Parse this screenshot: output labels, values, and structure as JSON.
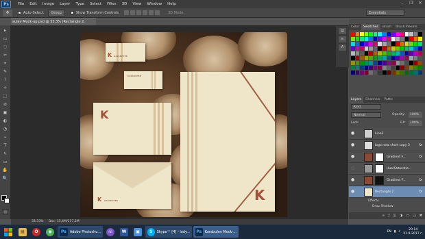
{
  "app": {
    "logo": "Ps"
  },
  "menu": [
    "File",
    "Edit",
    "Image",
    "Layer",
    "Type",
    "Select",
    "Filter",
    "3D",
    "View",
    "Window",
    "Help"
  ],
  "window_controls": [
    "–",
    "❐",
    "✕"
  ],
  "options_bar": {
    "auto_select_label": "Auto-Select:",
    "auto_select_value": "Group",
    "show_transform_label": "Show Transform Controls",
    "mode_3d_label": "3D Mode:",
    "workspace": "Essentials"
  },
  "document": {
    "tab_title": "aulev Mock-up.psd @ 33,3% (Rectangle 2, RGB/8)",
    "status": "Doc: 15,4M/117,2M",
    "zoom": "33.33%"
  },
  "mockup": {
    "brand_name": "КАРАБУЛЕВ",
    "logo_letter": "K"
  },
  "tools": [
    "▸",
    "▭",
    "◌",
    "✂",
    "⌖",
    "✎",
    "⌇",
    "✧",
    "⬚",
    "⊘",
    "▣",
    "◐",
    "◔",
    "⌁",
    "T",
    "↖",
    "▭",
    "✋",
    "🔍"
  ],
  "panels": {
    "color_tabs": [
      "Color",
      "Swatches",
      "Brush",
      "Brush Presets"
    ],
    "active_color_tab": "Swatches",
    "layers_tabs": [
      "Layers",
      "Channels",
      "Paths"
    ],
    "filter_kind": "Kind",
    "blend_mode": "Normal",
    "opacity_label": "Opacity:",
    "opacity_value": "100%",
    "lock_label": "Lock:",
    "fill_label": "Fill:",
    "fill_value": "100%"
  },
  "layers": [
    {
      "name": "Line2",
      "fx": ""
    },
    {
      "name": "logo new short copy 3",
      "fx": "fx"
    },
    {
      "name": "Gradient F...",
      "fx": "fx"
    },
    {
      "name": "Hue/Saturatio...",
      "fx": ""
    },
    {
      "name": "Gradient F...",
      "fx": "fx"
    },
    {
      "name": "Rectangle 2",
      "fx": "fx",
      "selected": true
    }
  ],
  "layer_effects": {
    "label": "Effects",
    "item": "Drop Shadow"
  },
  "taskbar": {
    "items": [
      {
        "label": "Adobe Photosho...",
        "icon": "Ps"
      },
      {
        "label": "Skype™ [4] - lady...",
        "icon": "S"
      },
      {
        "label": "Karabulev Mock-...",
        "icon": "Ps"
      }
    ],
    "language": "EN",
    "time": "20:14",
    "date": "21.9.2017 г."
  },
  "colors": {
    "accent": "#6d8cb4",
    "swatches": [
      "#ff0000",
      "#ff7f00",
      "#ffff00",
      "#7fff00",
      "#00ff00",
      "#00ff7f",
      "#00ffff",
      "#007fff",
      "#0000ff",
      "#7f00ff",
      "#ff00ff",
      "#ff007f",
      "#ffffff",
      "#c0c0c0",
      "#808080",
      "#000000"
    ]
  }
}
